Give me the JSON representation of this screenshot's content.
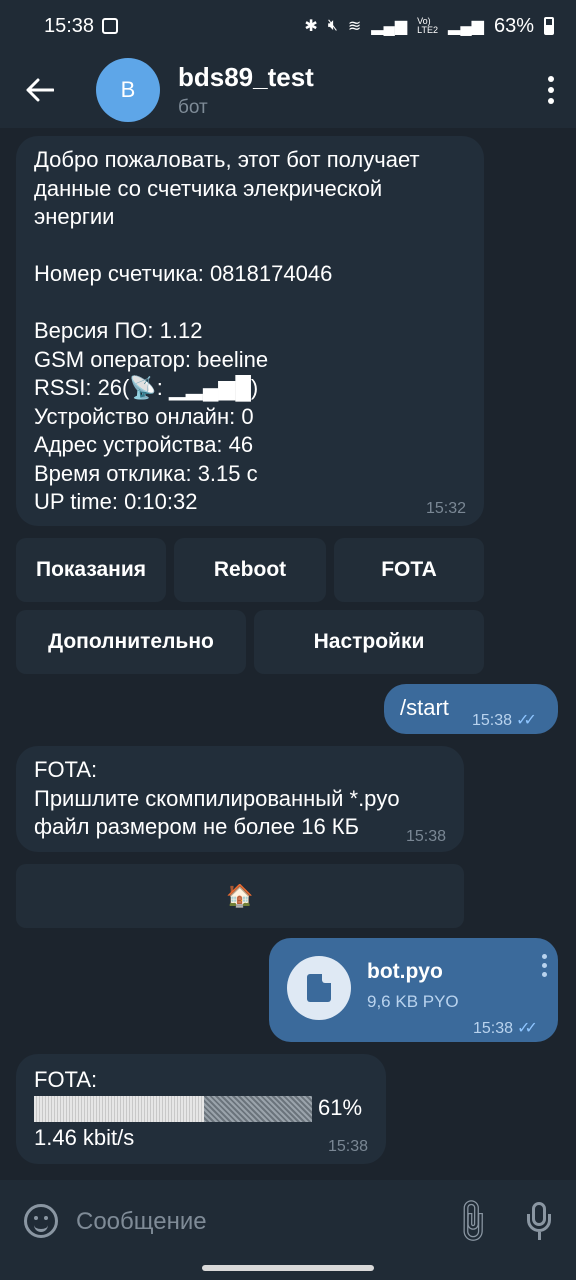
{
  "status_bar": {
    "time": "15:38",
    "icons": [
      "image-icon",
      "bluetooth-icon",
      "mute-icon",
      "wifi-icon",
      "signal-icon",
      "volte-icon",
      "signal-icon-2",
      "battery-icon"
    ],
    "volte": "Vo)\nLTE2",
    "battery": "63%"
  },
  "header": {
    "avatar_letter": "B",
    "title": "bds89_test",
    "subtitle": "бот"
  },
  "messages": {
    "welcome": {
      "text": "Добро пожаловать, этот бот получает\nданные со счетчика элекрической\nэнергии\n\nНомер счетчика: 0818174046\n\nВерсия ПО: 1.12\nGSM оператор: beeline\nRSSI: 26(📡: ▁▂▄▆█)\nУстройство онлайн: 0\nАдрес устройства: 46\nВремя отклика: 3.15 с\nUP time: 0:10:32",
      "time": "15:32"
    },
    "keyboard": {
      "row1": [
        "Показания",
        "Reboot",
        "FOTA"
      ],
      "row2": [
        "Дополнительно",
        "Настройки"
      ]
    },
    "start": {
      "text": "/start",
      "time": "15:38"
    },
    "fota_request": {
      "text": "FOTA:\nПришлите скомпилированный *.pyo\nфайл размером не более 16 КБ",
      "time": "15:38"
    },
    "home_button": {
      "label": "🏠"
    },
    "file": {
      "name": "bot.pyo",
      "meta": "9,6 KB PYO",
      "time": "15:38"
    },
    "fota_progress": {
      "label": "FOTA:",
      "progress": 0.61,
      "percent_text": "61%",
      "speed": "1.46 kbit/s",
      "time": "15:38"
    }
  },
  "input": {
    "placeholder": "Сообщение"
  },
  "colors": {
    "background": "#1c242d",
    "header": "#202b36",
    "incoming_bubble": "#222e3a",
    "outgoing_bubble": "#3b6a9b",
    "accent": "#5ea6e8"
  }
}
